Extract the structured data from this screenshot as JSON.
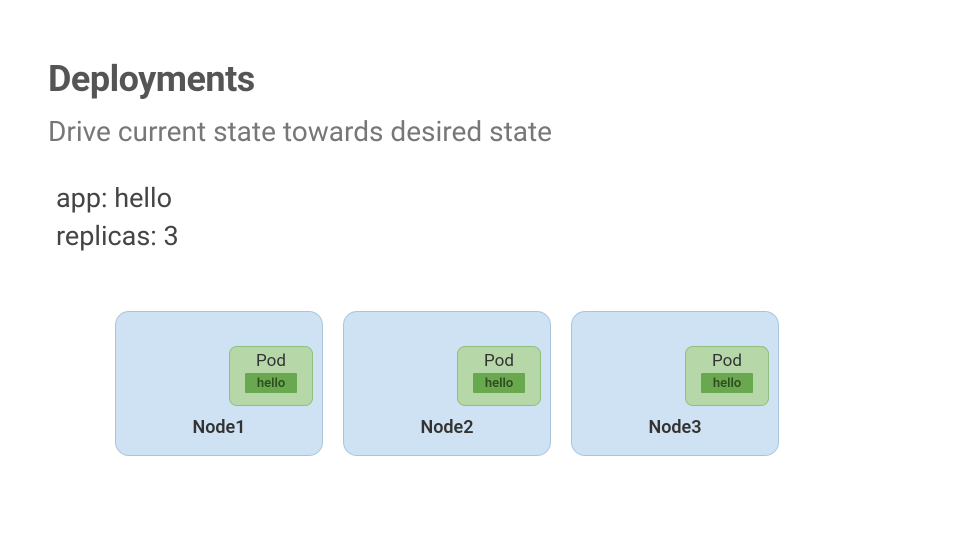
{
  "title": "Deployments",
  "subtitle": "Drive current state towards desired state",
  "spec": {
    "app_line": "app: hello",
    "replicas_line": "replicas: 3"
  },
  "pod_label": "Pod",
  "container_name": "hello",
  "nodes": [
    {
      "name": "Node1"
    },
    {
      "name": "Node2"
    },
    {
      "name": "Node3"
    }
  ]
}
